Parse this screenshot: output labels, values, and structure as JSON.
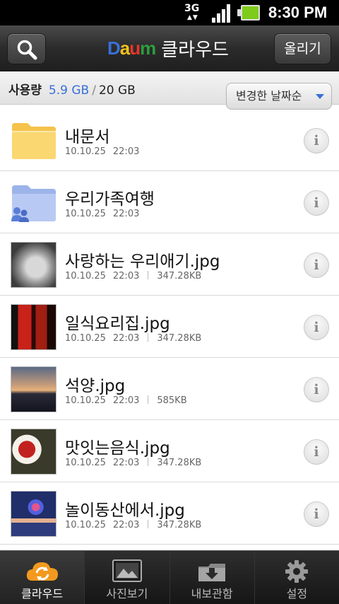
{
  "status_bar": {
    "network": "3G",
    "time": "8:30 PM"
  },
  "header": {
    "logo_text": "Daum",
    "title": "클라우드",
    "upload_label": "올리기",
    "search_icon": "search-icon"
  },
  "usage": {
    "label": "사용량",
    "used": "5.9 GB",
    "separator": "/",
    "total": "20 GB",
    "sort_label": "변경한 날짜순"
  },
  "files": [
    {
      "name": "내문서",
      "date": "10.10.25",
      "time": "22:03",
      "size": "",
      "type": "folder"
    },
    {
      "name": "우리가족여행",
      "date": "10.10.25",
      "time": "22:03",
      "size": "",
      "type": "shared-folder"
    },
    {
      "name": "사랑하는 우리애기.jpg",
      "date": "10.10.25",
      "time": "22:03",
      "size": "347.28KB",
      "type": "image"
    },
    {
      "name": "일식요리집.jpg",
      "date": "10.10.25",
      "time": "22:03",
      "size": "347.28KB",
      "type": "image"
    },
    {
      "name": "석양.jpg",
      "date": "10.10.25",
      "time": "22:03",
      "size": "585KB",
      "type": "image"
    },
    {
      "name": "맛잇는음식.jpg",
      "date": "10.10.25",
      "time": "22:03",
      "size": "347.28KB",
      "type": "image"
    },
    {
      "name": "놀이동산에서.jpg",
      "date": "10.10.25",
      "time": "22:03",
      "size": "347.28KB",
      "type": "image"
    }
  ],
  "tabs": [
    {
      "label": "클라우드",
      "icon": "cloud-sync-icon",
      "active": true
    },
    {
      "label": "사진보기",
      "icon": "photo-icon",
      "active": false
    },
    {
      "label": "내보관함",
      "icon": "download-box-icon",
      "active": false
    },
    {
      "label": "설정",
      "icon": "gear-icon",
      "active": false
    }
  ],
  "colors": {
    "accent": "#3a6fd8",
    "battery": "#7ecb1c",
    "cloud_orange": "#f39a1e"
  }
}
